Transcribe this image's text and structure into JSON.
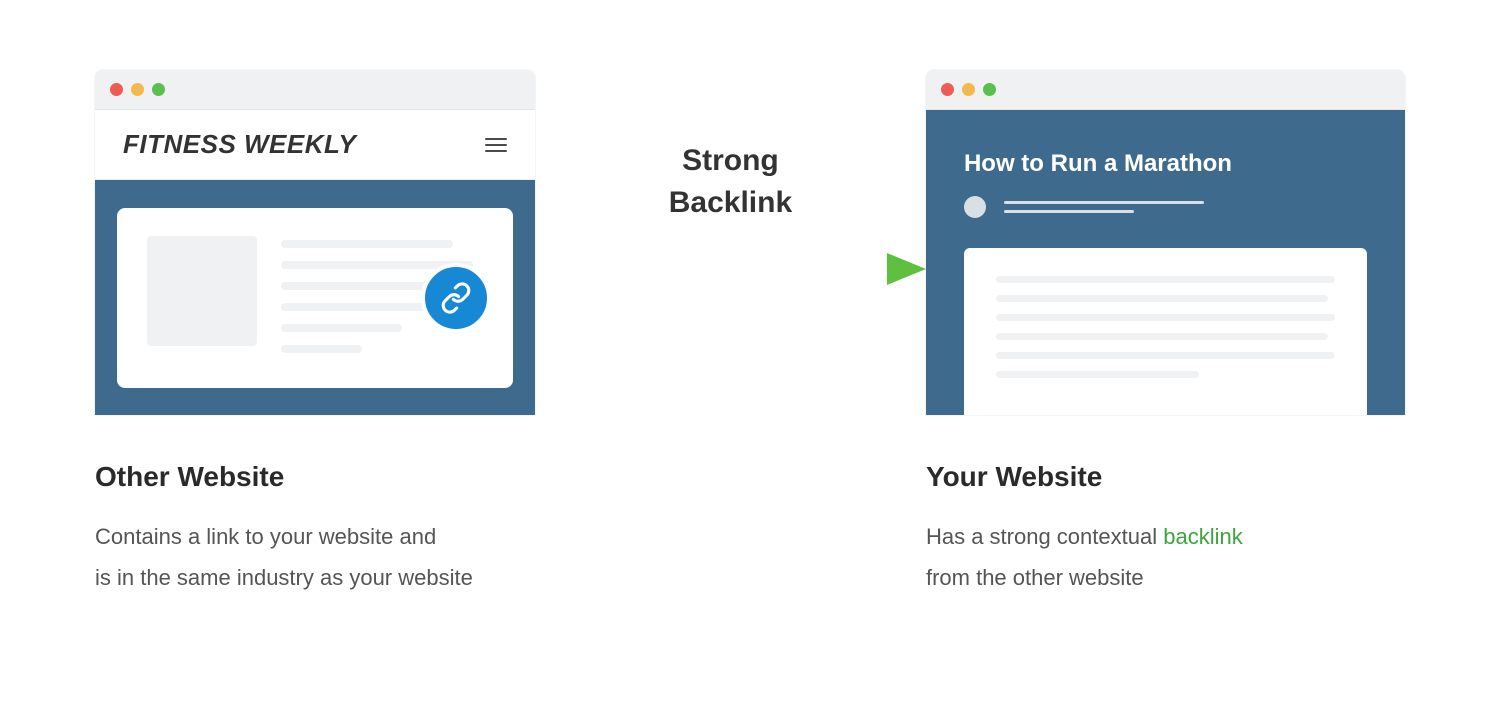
{
  "left": {
    "site_title": "FITNESS WEEKLY",
    "caption_title": "Other Website",
    "caption_body_1": "Contains a link to your website and",
    "caption_body_2": "is in the same industry as your website"
  },
  "arrow": {
    "label_line1": "Strong",
    "label_line2": "Backlink"
  },
  "right": {
    "article_title": "How to Run a Marathon",
    "caption_title": "Your Website",
    "caption_body_pre": "Has a strong contextual ",
    "caption_body_link": "backlink",
    "caption_body_post": "from the other website"
  },
  "colors": {
    "panel_blue": "#3e6b8d",
    "link_badge": "#1789d4",
    "accent_green": "#3aa63c"
  }
}
